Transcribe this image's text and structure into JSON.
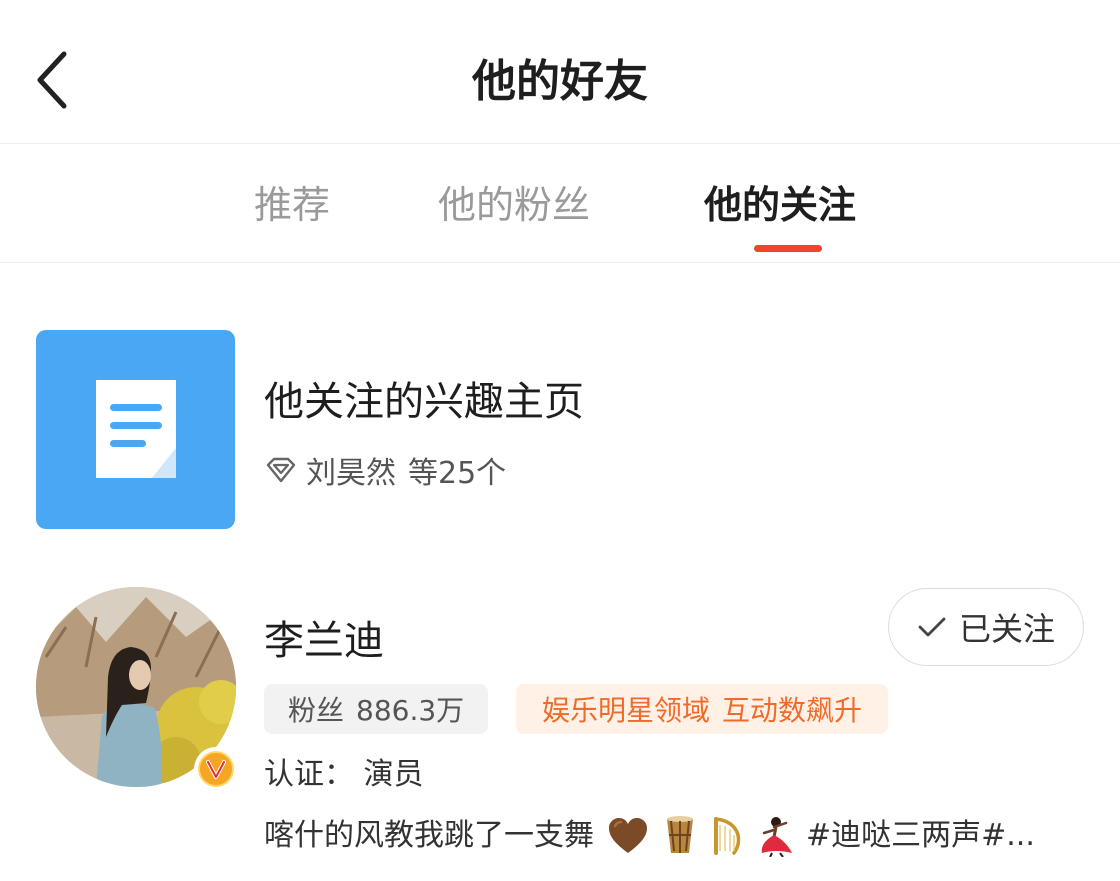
{
  "header": {
    "title": "他的好友",
    "back_icon": "chevron-left-icon"
  },
  "tabs": [
    {
      "label": "推荐",
      "active": false
    },
    {
      "label": "他的粉丝",
      "active": false
    },
    {
      "label": "他的关注",
      "active": true
    }
  ],
  "colors": {
    "accent": "#f0442c",
    "tile_blue": "#4aa7f4",
    "domain_tag_text": "#f06b2a",
    "domain_tag_bg": "#fff1e6",
    "verified": "#f5a623"
  },
  "interest_card": {
    "title": "他关注的兴趣主页",
    "icon": "document-icon",
    "sub_icon": "diamond-icon",
    "sub_name": "刘昊然",
    "sub_count": "等25个"
  },
  "user": {
    "name": "李兰迪",
    "follow_label": "已关注",
    "follow_icon": "check-icon",
    "fans_label": "粉丝",
    "fans_count": "886.3万",
    "domain_label": "娱乐明星领域",
    "domain_trend": "互动数飙升",
    "verify_text": "认证：  演员",
    "bio_text": "喀什的风教我跳了一支舞",
    "bio_emojis": [
      "🤎",
      "🪘",
      "🪕",
      "💃"
    ],
    "bio_tag": "#迪哒三两声#..."
  }
}
